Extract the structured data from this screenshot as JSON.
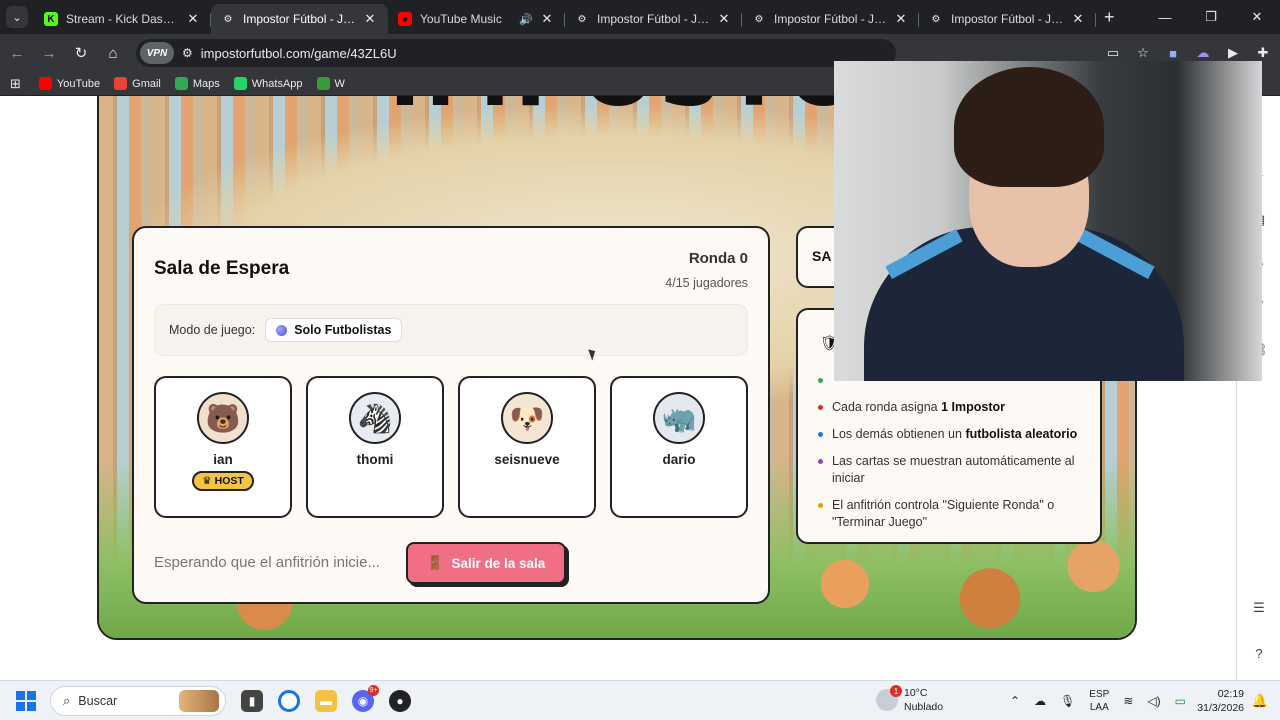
{
  "browser": {
    "tabs": [
      {
        "title": "Stream - Kick Dashboard",
        "favicon": "kick-icon",
        "color": "#53fc18",
        "active": false
      },
      {
        "title": "Impostor Fútbol - Juega co",
        "favicon": "soccer-ball-icon",
        "color": "#ffffff",
        "active": true
      },
      {
        "title": "YouTube Music",
        "favicon": "youtube-music-icon",
        "color": "#ff0000",
        "active": false,
        "audio": true
      },
      {
        "title": "Impostor Fútbol - Juega co",
        "favicon": "soccer-ball-icon",
        "color": "#ffffff",
        "active": false
      },
      {
        "title": "Impostor Fútbol - Juega co",
        "favicon": "soccer-ball-icon",
        "color": "#ffffff",
        "active": false
      },
      {
        "title": "Impostor Fútbol - Juega co",
        "favicon": "soccer-ball-icon",
        "color": "#ffffff",
        "active": false
      }
    ],
    "vpn_label": "VPN",
    "url": "impostorfutbol.com/game/43ZL6U",
    "bookmarks": [
      {
        "label": "YouTube",
        "icon": "youtube-icon",
        "color": "#ff0000"
      },
      {
        "label": "Gmail",
        "icon": "gmail-icon",
        "color": "#ea4335"
      },
      {
        "label": "Maps",
        "icon": "maps-icon",
        "color": "#34a853"
      },
      {
        "label": "WhatsApp",
        "icon": "whatsapp-icon",
        "color": "#25d366"
      },
      {
        "label": "W",
        "icon": "w-icon",
        "color": "#3a9b3a"
      }
    ]
  },
  "page": {
    "lobby_title": "Sala de Espera",
    "round_label": "Ronda 0",
    "players_count": "4/15 jugadores",
    "mode_label": "Modo de juego:",
    "mode_value": "Solo Futbolistas",
    "players": [
      {
        "name": "ian",
        "avatar": "bear-icon",
        "bg": "#f2e0cc",
        "host": true
      },
      {
        "name": "thomi",
        "avatar": "zebra-icon",
        "bg": "#e6ecf2",
        "host": false
      },
      {
        "name": "seisnueve",
        "avatar": "dog-icon",
        "bg": "#f4e6d2",
        "host": false
      },
      {
        "name": "dario",
        "avatar": "rhino-icon",
        "bg": "#e3e9ef",
        "host": false
      }
    ],
    "host_badge": "HOST",
    "waiting_text": "Esperando que el anfitrión inicie...",
    "leave_button": "Salir de la sala",
    "side_top_partial": "SA",
    "rules": [
      {
        "text": "",
        "color": "#34a853"
      },
      {
        "pre": "Cada ronda asigna ",
        "bold": "1 Impostor",
        "post": "",
        "color": "#d93025"
      },
      {
        "pre": "Los demás obtienen un ",
        "bold": "futbolista aleatorio",
        "post": "",
        "color": "#1a73e8"
      },
      {
        "pre": "Las cartas se muestran automáticamente al iniciar",
        "bold": "",
        "post": "",
        "color": "#8e44ad"
      },
      {
        "pre": "El anfitrión controla \"Siguiente Ronda\" o \"Terminar Juego\"",
        "bold": "",
        "post": "",
        "color": "#e6a100"
      }
    ]
  },
  "taskbar": {
    "search_placeholder": "Buscar",
    "weather_temp": "10°C",
    "weather_desc": "Nublado",
    "weather_badge": "1",
    "lang_top": "ESP",
    "lang_bottom": "LAA",
    "time": "02:19",
    "date": "31/3/2026",
    "discord_badge": "9+"
  }
}
